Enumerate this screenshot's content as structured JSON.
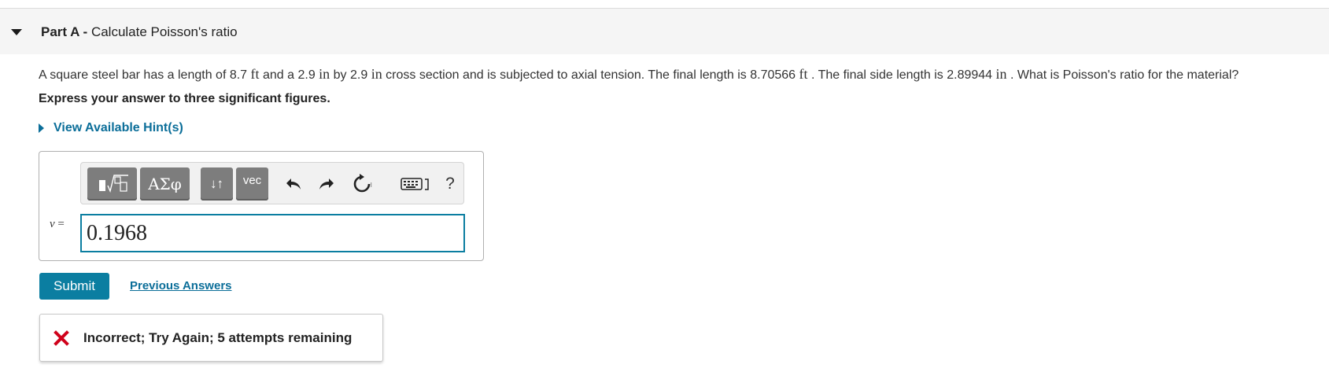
{
  "part": {
    "label": "Part A -",
    "title": "Calculate Poisson's ratio"
  },
  "question": {
    "s1": "A square steel bar has a length of 8.7",
    "u1": "ft",
    "s2": "and a 2.9",
    "u2": "in",
    "s3": "by 2.9",
    "u3": "in",
    "s4": "cross section and is subjected to axial tension. The final length is 8.70566",
    "u4": "ft",
    "s5": ". The final side length is 2.89944",
    "u5": "in",
    "s6": ". What is Poisson's ratio for the material?"
  },
  "instruction": "Express your answer to three significant figures.",
  "hint": {
    "label": "View Available Hint(s)"
  },
  "toolbar": {
    "greek_label": "ΑΣφ",
    "arrows_label": "↓↑",
    "vec_label": "vec",
    "help_label": "?"
  },
  "answer": {
    "variable": "ν",
    "equals": "=",
    "value": "0.1968"
  },
  "actions": {
    "submit_label": "Submit",
    "previous_label": "Previous Answers"
  },
  "feedback": {
    "text": "Incorrect; Try Again; 5 attempts remaining",
    "icon_color": "#d0021b"
  },
  "colors": {
    "accent": "#0b7ea1",
    "link": "#0b6e99"
  }
}
